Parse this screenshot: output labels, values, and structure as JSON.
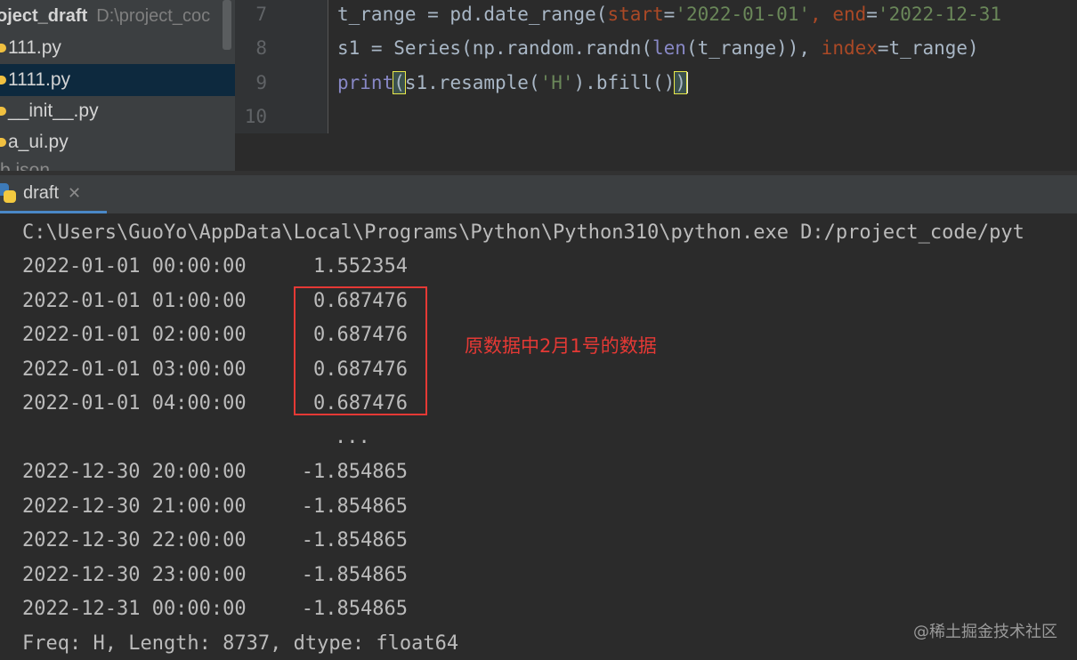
{
  "project": {
    "name": "oject_draft",
    "path": "D:\\project_coc",
    "files": [
      {
        "name": "111.py",
        "selected": false
      },
      {
        "name": "1111.py",
        "selected": true
      },
      {
        "name": "__init__.py",
        "selected": false
      },
      {
        "name": "a_ui.py",
        "selected": false
      },
      {
        "name": "b.json",
        "selected": false
      }
    ]
  },
  "editor": {
    "line_numbers": [
      "7",
      "8",
      "9",
      "10"
    ],
    "line7": {
      "a": "t_range = pd.date_range(",
      "kw1": "start",
      "eq1": "=",
      "s1": "'2022-01-01'",
      "c1": ", ",
      "kw2": "end",
      "eq2": "=",
      "s2": "'2022-12-31"
    },
    "line8": {
      "a": "s1 = Series(np.random.randn(",
      "bi": "len",
      "b": "(t_range)), ",
      "kw": "index",
      "c": "=t_range)"
    },
    "line9": {
      "bi": "print",
      "po": "(",
      "a": "s1.resample(",
      "s": "'H'",
      "b": ").bfill()",
      "pc": ")"
    }
  },
  "run": {
    "tab_label": "draft",
    "close_glyph": "✕",
    "command": "C:\\Users\\GuoYo\\AppData\\Local\\Programs\\Python\\Python310\\python.exe D:/project_code/pyt",
    "rows": [
      {
        "ts": "2022-01-01 00:00:00",
        "val": "1.552354"
      },
      {
        "ts": "2022-01-01 01:00:00",
        "val": "0.687476"
      },
      {
        "ts": "2022-01-01 02:00:00",
        "val": "0.687476"
      },
      {
        "ts": "2022-01-01 03:00:00",
        "val": "0.687476"
      },
      {
        "ts": "2022-01-01 04:00:00",
        "val": "0.687476"
      }
    ],
    "ellipsis": "...",
    "rows2": [
      {
        "ts": "2022-12-30 20:00:00",
        "val": "-1.854865"
      },
      {
        "ts": "2022-12-30 21:00:00",
        "val": "-1.854865"
      },
      {
        "ts": "2022-12-30 22:00:00",
        "val": "-1.854865"
      },
      {
        "ts": "2022-12-30 23:00:00",
        "val": "-1.854865"
      },
      {
        "ts": "2022-12-31 00:00:00",
        "val": "-1.854865"
      }
    ],
    "footer": "Freq: H, Length: 8737, dtype: float64"
  },
  "annotation": {
    "text": "原数据中2月1号的数据",
    "color": "#e53935"
  },
  "watermark": "@稀土掘金技术社区"
}
